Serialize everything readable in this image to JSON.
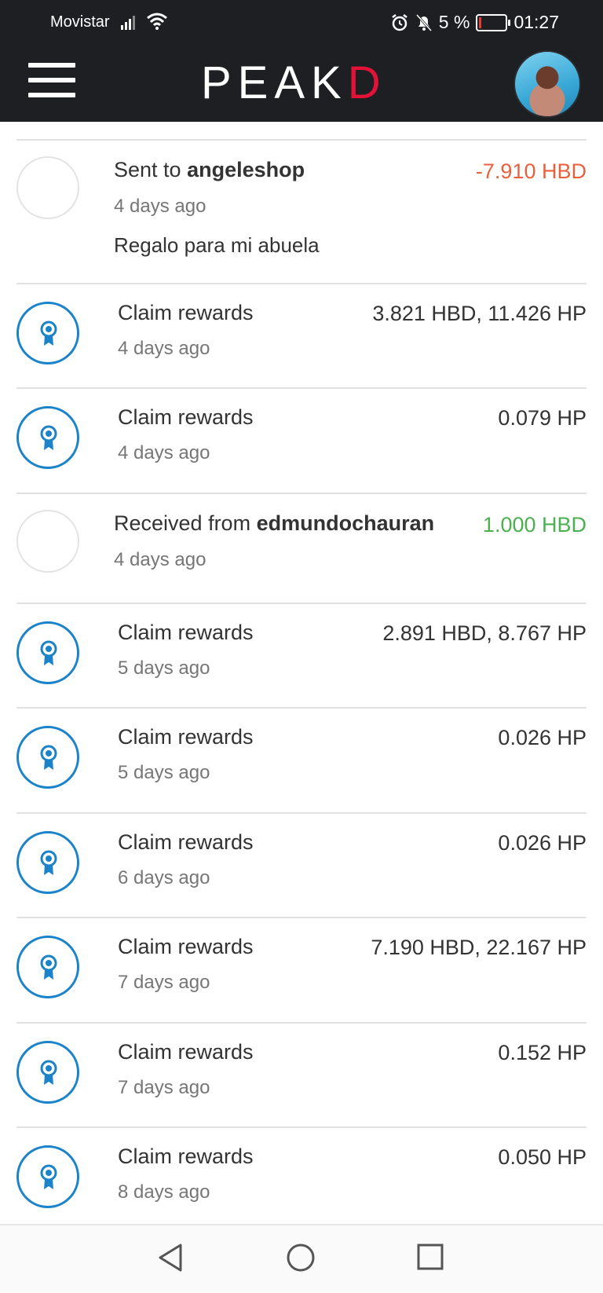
{
  "status_bar": {
    "carrier": "Movistar",
    "battery": "5 %",
    "time": "01:27"
  },
  "header": {
    "logo_main": "PEAK",
    "logo_accent": "D"
  },
  "transactions": [
    {
      "type": "sent",
      "prefix": "Sent to ",
      "user": "angeleshop",
      "time": "4 days ago",
      "memo": "Regalo para mi abuela",
      "amount": "-7.910 HBD"
    },
    {
      "type": "claim",
      "title": "Claim rewards",
      "time": "4 days ago",
      "amount": "3.821 HBD, 11.426 HP"
    },
    {
      "type": "claim",
      "title": "Claim rewards",
      "time": "4 days ago",
      "amount": "0.079 HP"
    },
    {
      "type": "received",
      "prefix": "Received from ",
      "user": "edmundochauran",
      "time": "4 days ago",
      "amount": "1.000 HBD"
    },
    {
      "type": "claim",
      "title": "Claim rewards",
      "time": "5 days ago",
      "amount": "2.891 HBD, 8.767 HP"
    },
    {
      "type": "claim",
      "title": "Claim rewards",
      "time": "5 days ago",
      "amount": "0.026 HP"
    },
    {
      "type": "claim",
      "title": "Claim rewards",
      "time": "6 days ago",
      "amount": "0.026 HP"
    },
    {
      "type": "claim",
      "title": "Claim rewards",
      "time": "7 days ago",
      "amount": "7.190 HBD, 22.167 HP"
    },
    {
      "type": "claim",
      "title": "Claim rewards",
      "time": "7 days ago",
      "amount": "0.152 HP"
    },
    {
      "type": "claim",
      "title": "Claim rewards",
      "time": "8 days ago",
      "amount": "0.050 HP"
    }
  ],
  "colors": {
    "header_bg": "#1d1f23",
    "accent_red": "#e31337",
    "icon_blue": "#1a83c9",
    "negative": "#e8603c",
    "positive": "#4caf50"
  }
}
